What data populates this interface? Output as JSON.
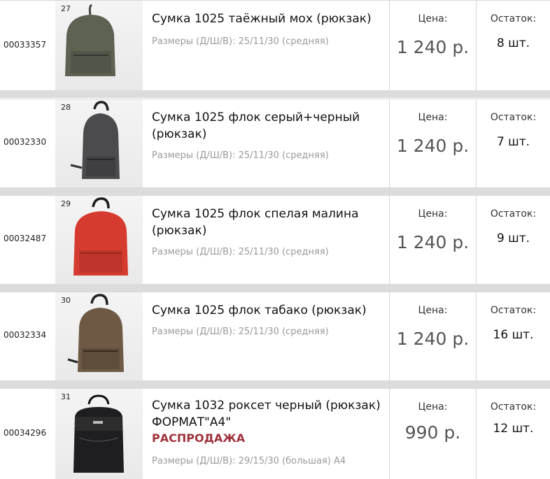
{
  "items": [
    {
      "article": "00033357",
      "num": "27",
      "title": "Сумка 1025 таёжный мох (рюкзак)",
      "sale": "",
      "sizes": "Размеры (Д/Ш/В): 25/11/30 (средняя)",
      "price_label": "Цена:",
      "price": "1 240 р.",
      "stock_label": "Остаток:",
      "stock": "8 шт.",
      "bag_color": "#5d6253"
    },
    {
      "article": "00032330",
      "num": "28",
      "title": "Сумка 1025 флок серый+черный (рюкзак)",
      "sale": "",
      "sizes": "Размеры (Д/Ш/В): 25/11/30 (средняя)",
      "price_label": "Цена:",
      "price": "1 240 р.",
      "stock_label": "Остаток:",
      "stock": "7 шт.",
      "bag_color": "#4b4b4e"
    },
    {
      "article": "00032487",
      "num": "29",
      "title": "Сумка 1025 флок спелая малина (рюкзак)",
      "sale": "",
      "sizes": "Размеры (Д/Ш/В): 25/11/30 (средняя)",
      "price_label": "Цена:",
      "price": "1 240 р.",
      "stock_label": "Остаток:",
      "stock": "9 шт.",
      "bag_color": "#d63b30"
    },
    {
      "article": "00032334",
      "num": "30",
      "title": "Сумка 1025 флок табако (рюкзак)",
      "sale": "",
      "sizes": "Размеры (Д/Ш/В): 25/11/30 (средняя)",
      "price_label": "Цена:",
      "price": "1 240 р.",
      "stock_label": "Остаток:",
      "stock": "16 шт.",
      "bag_color": "#6e5a44"
    },
    {
      "article": "00034296",
      "num": "31",
      "title": "Сумка 1032 роксет черный (рюкзак) ФОРМАТ\"А4\"",
      "sale": "РАСПРОДАЖА",
      "sizes": "Размеры (Д/Ш/В): 29/15/30 (большая) А4",
      "price_label": "Цена:",
      "price": "990 р.",
      "stock_label": "Остаток:",
      "stock": "12 шт.",
      "bag_color": "#1e1e20"
    }
  ]
}
